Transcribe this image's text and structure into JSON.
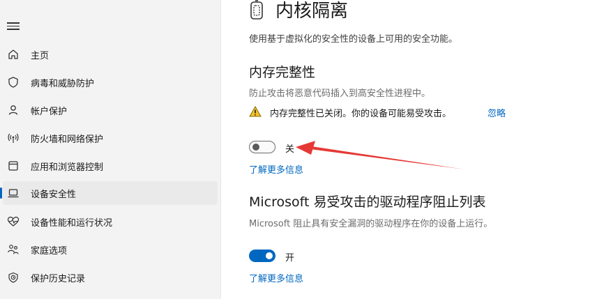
{
  "sidebar": {
    "items": [
      {
        "label": "主页",
        "icon": "home-icon"
      },
      {
        "label": "病毒和威胁防护",
        "icon": "shield-icon"
      },
      {
        "label": "帐户保护",
        "icon": "person-icon"
      },
      {
        "label": "防火墙和网络保护",
        "icon": "wireless-icon"
      },
      {
        "label": "应用和浏览器控制",
        "icon": "app-window-icon"
      },
      {
        "label": "设备安全性",
        "icon": "laptop-icon",
        "active": true
      },
      {
        "label": "设备性能和运行状况",
        "icon": "heart-pulse-icon"
      },
      {
        "label": "家庭选项",
        "icon": "family-icon"
      },
      {
        "label": "保护历史记录",
        "icon": "history-icon"
      }
    ]
  },
  "page": {
    "title": "内核隔离",
    "icon": "core-isolation-chip-icon",
    "description": "使用基于虚拟化的安全性的设备上可用的安全功能。"
  },
  "memory_integrity": {
    "title": "内存完整性",
    "description": "防止攻击将恶意代码插入到高安全性进程中。",
    "warning": "内存完整性已关闭。你的设备可能易受攻击。",
    "ignore_label": "忽略",
    "toggle_state": "off",
    "toggle_label": "关",
    "learn_more": "了解更多信息"
  },
  "driver_blocklist": {
    "title": "Microsoft 易受攻击的驱动程序阻止列表",
    "description": "Microsoft 阻止具有安全漏洞的驱动程序在你的设备上运行。",
    "toggle_state": "on",
    "toggle_label": "开",
    "learn_more": "了解更多信息"
  },
  "colors": {
    "accent": "#0067c0",
    "annotation_arrow": "#e53935",
    "warning": "#f2c12e"
  }
}
